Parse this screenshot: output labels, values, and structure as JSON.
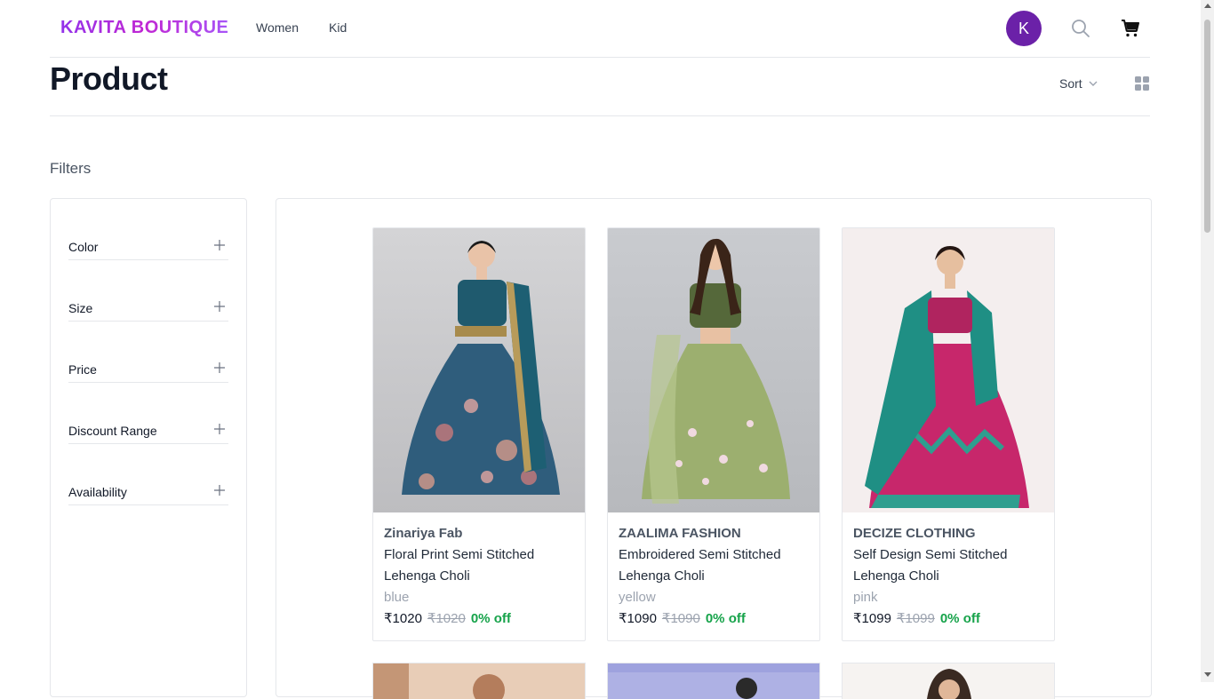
{
  "header": {
    "brand": "KAVITA BOUTIQUE",
    "nav": [
      {
        "label": "Women"
      },
      {
        "label": "Kid"
      }
    ],
    "avatar_initial": "K",
    "avatar_color": "#6b21a8"
  },
  "page": {
    "title": "Product",
    "sort_label": "Sort"
  },
  "filters": {
    "heading": "Filters",
    "items": [
      {
        "label": "Color"
      },
      {
        "label": "Size"
      },
      {
        "label": "Price"
      },
      {
        "label": "Discount Range"
      },
      {
        "label": "Availability"
      }
    ]
  },
  "products": [
    {
      "brand": "Zinariya Fab",
      "title": "Floral Print Semi Stitched Lehenga Choli",
      "color": "blue",
      "price": "₹1020",
      "mrp": "₹1020",
      "discount": "0% off"
    },
    {
      "brand": "ZAALIMA FASHION",
      "title": "Embroidered Semi Stitched Lehenga Choli",
      "color": "yellow",
      "price": "₹1090",
      "mrp": "₹1090",
      "discount": "0% off"
    },
    {
      "brand": "DECIZE CLOTHING",
      "title": "Self Design Semi Stitched Lehenga Choli",
      "color": "pink",
      "price": "₹1099",
      "mrp": "₹1099",
      "discount": "0% off"
    }
  ],
  "colors": {
    "brand_gradient": [
      "#9333ea",
      "#c026d3"
    ],
    "discount": "#16a34a"
  },
  "icons": {
    "search": "search-icon",
    "cart": "cart-icon",
    "sort": "chevron-down-icon",
    "grid": "grid-view-icon",
    "expand": "plus-icon"
  }
}
